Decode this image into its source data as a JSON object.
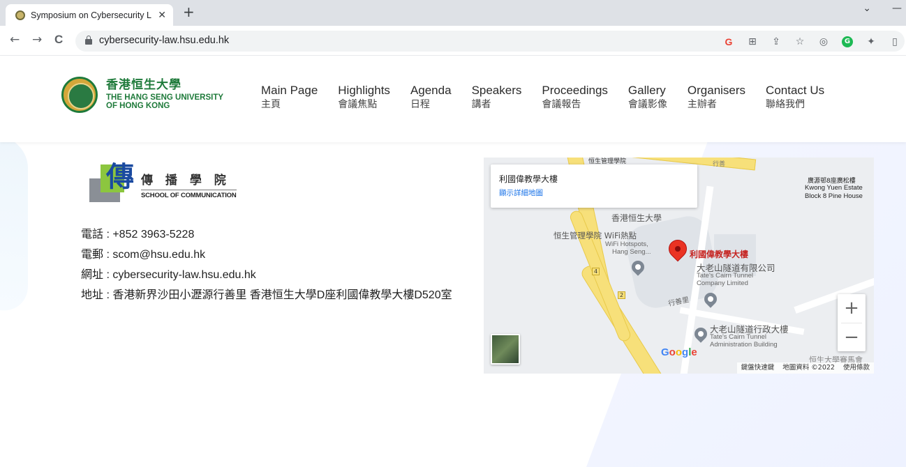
{
  "browser": {
    "tab_title": "Symposium on Cybersecurity L",
    "tab_close": "✕",
    "new_tab": "+",
    "url": "cybersecurity-law.hsu.edu.hk",
    "back": "←",
    "forward": "→",
    "reload": "C",
    "extension_icons": [
      "google-icon",
      "translate-icon",
      "share-icon",
      "star-icon",
      "extension-icon",
      "grammarly-icon",
      "puzzle-icon",
      "sidepanel-icon"
    ]
  },
  "header": {
    "logo_cn": "香港恒生大學",
    "logo_en_line1": "THE HANG SENG UNIVERSITY",
    "logo_en_line2": "OF HONG KONG",
    "nav": [
      {
        "en": "Main Page",
        "cn": "主頁"
      },
      {
        "en": "Highlights",
        "cn": "會議焦點"
      },
      {
        "en": "Agenda",
        "cn": "日程"
      },
      {
        "en": "Speakers",
        "cn": "講者"
      },
      {
        "en": "Proceedings",
        "cn": "會議報告"
      },
      {
        "en": "Gallery",
        "cn": "會議影像"
      },
      {
        "en": "Organisers",
        "cn": "主辦者"
      },
      {
        "en": "Contact Us",
        "cn": "聯絡我們"
      }
    ]
  },
  "school": {
    "logo_char": "傳",
    "name_cn": "傳 播 學 院",
    "name_en": "SCHOOL OF COMMUNICATION"
  },
  "contact": {
    "phone": "電話 : +852 3963-5228",
    "email": "電郵 : scom@hsu.edu.hk",
    "website": "網址 : cybersecurity-law.hsu.edu.hk",
    "address": "地址 : 香港新界沙田小瀝源行善里 香港恒生大學D座利國偉教學大樓D520室"
  },
  "map": {
    "info_title": "利國偉教學大樓",
    "info_link": "顯示詳細地圖",
    "labels": {
      "top_school": "恒生管理學院",
      "kwong_yuen_cn": "廣源邨8座廣松樓",
      "kwong_yuen_en1": "Kwong Yuen Estate",
      "kwong_yuen_en2": "Block 8 Pine House",
      "hsu": "香港恒生大學",
      "wifi_cn": "恒生管理學院 WiFi熱點",
      "wifi_en1": "WiFi Hotspots,",
      "wifi_en2": "Hang Seng...",
      "lee_building": "利國偉教學大樓",
      "tates_cn": "大老山隧道有限公司",
      "tates_en1": "Tate's Cairn Tunnel",
      "tates_en2": "Company Limited",
      "hang_shin": "行善里",
      "admin_cn": "大老山隧道行政大樓",
      "admin_en1": "Tate's Cairn Tunnel",
      "admin_en2": "Administration Building",
      "bottom_right": "恒生大學賽馬會",
      "route4": "4",
      "route2": "2",
      "top_road": "行善"
    },
    "zoom_in": "+",
    "zoom_out": "−",
    "google": "Google",
    "attribution": {
      "shortcuts": "鍵盤快速鍵",
      "data": "地圖資料 ©2022",
      "terms": "使用條款"
    },
    "pin_color": "#ea3323"
  }
}
